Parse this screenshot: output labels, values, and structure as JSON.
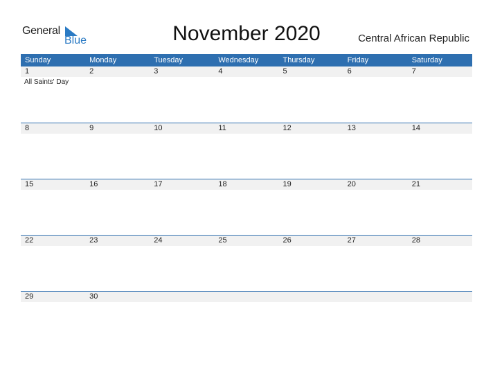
{
  "logo": {
    "line1": "General",
    "line2": "Blue"
  },
  "header": {
    "title": "November 2020",
    "country": "Central African Republic"
  },
  "days": [
    "Sunday",
    "Monday",
    "Tuesday",
    "Wednesday",
    "Thursday",
    "Friday",
    "Saturday"
  ],
  "weeks": [
    {
      "dates": [
        "1",
        "2",
        "3",
        "4",
        "5",
        "6",
        "7"
      ],
      "events": [
        "All Saints' Day",
        "",
        "",
        "",
        "",
        "",
        ""
      ]
    },
    {
      "dates": [
        "8",
        "9",
        "10",
        "11",
        "12",
        "13",
        "14"
      ],
      "events": [
        "",
        "",
        "",
        "",
        "",
        "",
        ""
      ]
    },
    {
      "dates": [
        "15",
        "16",
        "17",
        "18",
        "19",
        "20",
        "21"
      ],
      "events": [
        "",
        "",
        "",
        "",
        "",
        "",
        ""
      ]
    },
    {
      "dates": [
        "22",
        "23",
        "24",
        "25",
        "26",
        "27",
        "28"
      ],
      "events": [
        "",
        "",
        "",
        "",
        "",
        "",
        ""
      ]
    },
    {
      "dates": [
        "29",
        "30",
        "",
        "",
        "",
        "",
        ""
      ],
      "events": [
        "",
        "",
        "",
        "",
        "",
        "",
        ""
      ]
    }
  ],
  "colors": {
    "accent": "#2e6fb0",
    "logo_blue": "#2a7ac4",
    "date_bar": "#f1f1f1"
  }
}
